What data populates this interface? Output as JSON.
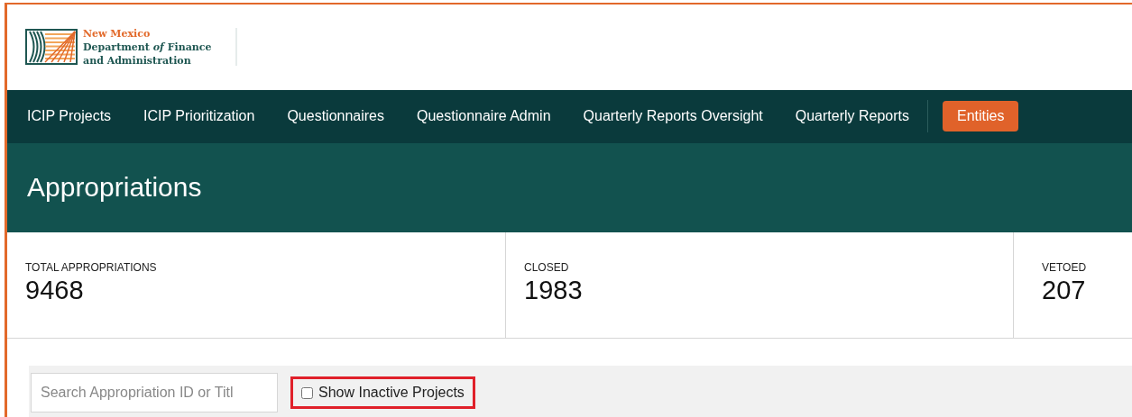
{
  "logo": {
    "lines": [
      "New Mexico",
      "Department *of* Finance",
      "and Administration"
    ]
  },
  "nav": {
    "items": [
      {
        "label": "ICIP Projects",
        "selected": false
      },
      {
        "label": "ICIP Prioritization",
        "selected": false
      },
      {
        "label": "Questionnaires",
        "selected": false
      },
      {
        "label": "Questionnaire Admin",
        "selected": false
      },
      {
        "label": "Quarterly Reports Oversight",
        "selected": false
      },
      {
        "label": "Quarterly Reports",
        "selected": false
      },
      {
        "label": "Entities",
        "selected": true
      }
    ]
  },
  "page_title": "Appropriations",
  "stats": [
    {
      "label": "TOTAL APPROPRIATIONS",
      "value": "9468"
    },
    {
      "label": "CLOSED",
      "value": "1983"
    },
    {
      "label": "VETOED",
      "value": "207"
    }
  ],
  "filters": {
    "search": {
      "placeholder": "Search Appropriation ID or Titl"
    },
    "show_inactive": {
      "label": "Show Inactive Projects",
      "checked": false,
      "highlighted": true
    }
  }
}
